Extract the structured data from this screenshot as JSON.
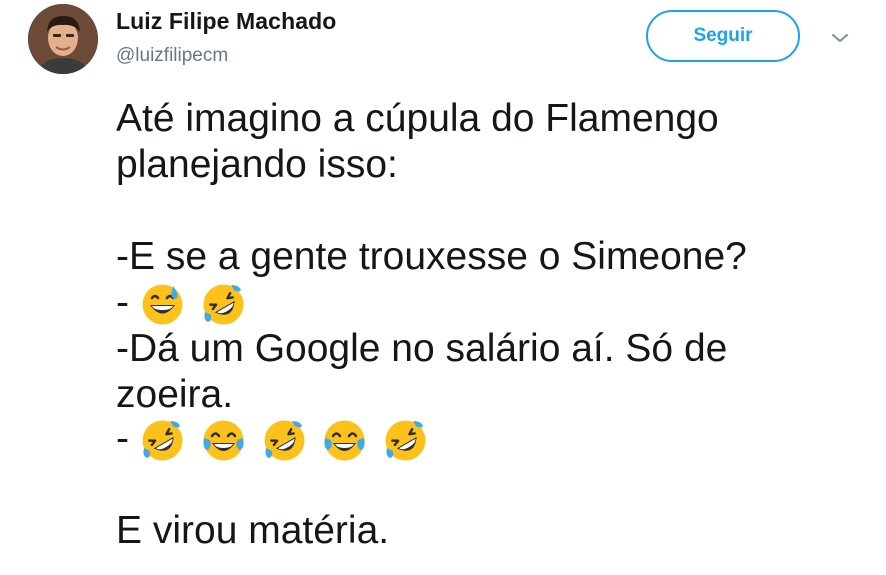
{
  "tweet": {
    "author": {
      "display_name": "Luiz Filipe Machado",
      "handle": "@luizfilipecm",
      "avatar_icon": "profile-photo"
    },
    "follow_button_label": "Seguir",
    "menu_icon": "chevron-down-icon",
    "text_lines": [
      "Até imagino a cúpula do Flamengo",
      "planejando isso:",
      "",
      "-E se a gente trouxesse o Simeone?",
      "-",
      "-Dá um Google no salário aí. Só de",
      "zoeira.",
      "-",
      "",
      "E virou matéria."
    ],
    "emoji_line_1": [
      "grinning-face-with-sweat-icon",
      "rolling-on-the-floor-laughing-icon"
    ],
    "emoji_line_2": [
      "rolling-on-the-floor-laughing-icon",
      "face-with-tears-of-joy-icon",
      "rolling-on-the-floor-laughing-icon",
      "face-with-tears-of-joy-icon",
      "rolling-on-the-floor-laughing-icon"
    ],
    "colors": {
      "accent": "#1da1f2",
      "text": "#14171a",
      "secondary_text": "#657786",
      "emoji_yellow": "#fcc21b"
    }
  }
}
